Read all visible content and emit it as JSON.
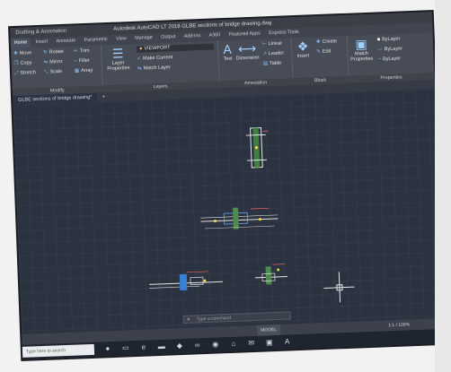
{
  "app": {
    "title": "Autodesk AutoCAD LT 2018   GLBE sections of bridge drawing.dwg",
    "workspace": "Drafting & Annotation"
  },
  "tabs": [
    "Home",
    "Insert",
    "Annotate",
    "Parametric",
    "View",
    "Manage",
    "Output",
    "Add-ins",
    "A360",
    "Featured Apps",
    "Express Tools"
  ],
  "ribbon": {
    "modify": {
      "label": "Modify",
      "tools": [
        "Move",
        "Rotate",
        "Trim",
        "Copy",
        "Mirror",
        "Fillet",
        "Stretch",
        "Scale",
        "Array"
      ]
    },
    "layers": {
      "label": "Layers",
      "layer_name": "VIEWPORT",
      "properties": "Layer Properties",
      "make_current": "Make Current",
      "match_layer": "Match Layer"
    },
    "annotation": {
      "label": "Annotation",
      "text": "Text",
      "dimension": "Dimension",
      "linear": "Linear",
      "leader": "Leader",
      "table": "Table"
    },
    "block": {
      "label": "Block",
      "insert": "Insert",
      "create": "Create",
      "edit": "Edit"
    },
    "properties": {
      "label": "Properties",
      "match": "Match Properties",
      "bylayer1": "ByLayer",
      "bylayer2": "ByLayer",
      "bylayer3": "ByLayer"
    }
  },
  "document_tab": "GLBE sections of bridge drawing*",
  "command_placeholder": "Type a command",
  "status": {
    "model": "MODEL",
    "scale": "1:1 / 100%"
  },
  "taskbar": {
    "search_placeholder": "Type here to search"
  },
  "colors": {
    "canvas": "#2b3240",
    "ribbon": "#474c56",
    "accent": "#8fc3ff"
  }
}
